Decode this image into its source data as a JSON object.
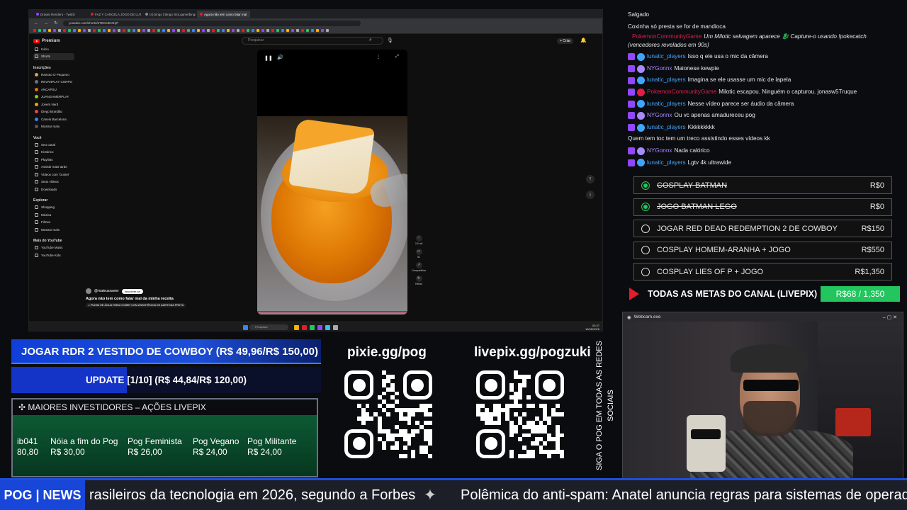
{
  "browser": {
    "tabs": [
      {
        "label": "Drawis Rendero - Twitch",
        "color": "#9146ff"
      },
      {
        "label": "FAZ Y CANCELA JOGO DE LUTA HOJE",
        "color": "#e11d2d"
      },
      {
        "label": "(4) bingo | Bingo Slot.game/bingo",
        "color": "#888888"
      },
      {
        "label": "Agora não tem como falar mal",
        "color": "#e11d2d",
        "active": true
      }
    ],
    "url": "youtube.com/shorts/6TDGs3N4HjP",
    "search_placeholder": "Pesquisar",
    "create_label": "+ Criar"
  },
  "yt_sidebar": {
    "brand": "Premium",
    "main": [
      "Início",
      "Shorts"
    ],
    "subs_title": "Inscrições",
    "subs": [
      "Ramoto O Pequeno",
      "REVANPLAY CORPO",
      "ANCAPSU",
      "JUANGAMERPLAY",
      "Jovem Nerd",
      "Diego Brandão",
      "Canelo Barcelona",
      "Mostrar mais"
    ],
    "you_title": "Você",
    "you": [
      "Seu canal",
      "Histórico",
      "Playlists",
      "Assistir mais tarde",
      "Vídeos com 'Gostei'",
      "Seus vídeos",
      "Downloads"
    ],
    "explore_title": "Explorar",
    "explore": [
      "Shopping",
      "Música",
      "Filmes",
      "Mostrar mais"
    ],
    "more_title": "Mais do YouTube",
    "more": [
      "YouTube Music",
      "YouTube Kids"
    ]
  },
  "short": {
    "channel": "@mateusxavier",
    "subscribe": "Inscrever-se",
    "title": "Agora não tem como falar mal da minha receita",
    "caption": "♫ PUDIM DE ÁGUA PARA COMER COM ASSISTÊNCIA DE AZEITONA PRETA",
    "side": [
      {
        "icon": "♡",
        "label": "2,5 mil"
      },
      {
        "icon": "▭",
        "label": "51"
      },
      {
        "icon": "↗",
        "label": "Compartilhar"
      },
      {
        "icon": "↻",
        "label": "Remix"
      }
    ]
  },
  "windows_taskbar": {
    "search": "Pesquisar",
    "time": "03:37",
    "date": "16/06/2026"
  },
  "chat": [
    {
      "user": "",
      "text": "Salgado",
      "color": "#e8e8e8"
    },
    {
      "user": "",
      "text": "Coxinha só presta se for de mandioca",
      "color": "#e8e8e8"
    },
    {
      "user": "PokemonCommunityGame",
      "text": "Um Milotic selvagem aparece 🐉 Capture-o usando !pokecatch (vencedores revelados em 90s)",
      "color": "#e11d48",
      "italic": true
    },
    {
      "user": "lunatic_players",
      "text": "Isso q ele usa o mic da câmera",
      "color": "#3ea6ff"
    },
    {
      "user": "NYGonnx",
      "text": "Maionese kewpie",
      "color": "#a78bfa"
    },
    {
      "user": "lunatic_players",
      "text": "Imagina se ele usasse um mic de lapela",
      "color": "#3ea6ff"
    },
    {
      "user": "PokemonCommunityGame",
      "text": "Milotic escapou. Ninguém o capturou. jonasw5Truque",
      "color": "#e11d48"
    },
    {
      "user": "lunatic_players",
      "text": "Nesse vídeo parece ser áudio da câmera",
      "color": "#3ea6ff"
    },
    {
      "user": "NYGonnx",
      "text": "Ou vc apenas amadureceu pog",
      "color": "#a78bfa"
    },
    {
      "user": "lunatic_players",
      "text": "Kkkkkkkkk",
      "color": "#3ea6ff"
    },
    {
      "user": "",
      "text": "Quem tem toc tem um treco assistindo esses vídeos kk",
      "color": "#e8e8e8"
    },
    {
      "user": "NYGonnx",
      "text": "Nada calórico",
      "color": "#a78bfa"
    },
    {
      "user": "lunatic_players",
      "text": "Lgtv 4k ultrawide",
      "color": "#3ea6ff"
    }
  ],
  "goals": [
    {
      "label": "COSPLAY BATMAN",
      "value": "R$0",
      "done": true
    },
    {
      "label": "JOGO BATMAN LEGO",
      "value": "R$0",
      "done": true
    },
    {
      "label": "JOGAR RED DEAD REDEMPTION 2 DE COWBOY",
      "value": "R$150",
      "done": false
    },
    {
      "label": "COSPLAY HOMEM-ARANHA + JOGO",
      "value": "R$550",
      "done": false
    },
    {
      "label": "COSPLAY LIES OF P + JOGO",
      "value": "R$1,350",
      "done": false
    }
  ],
  "meta": {
    "label": "TODAS AS METAS DO CANAL (LIVEPIX)",
    "value": "R$68 / 1,350"
  },
  "webcam": {
    "title": "Webcam.exe"
  },
  "rdr": {
    "label": "JOGAR RDR 2 VESTIDO DE COWBOY (R$ 49,96/R$ 150,00)"
  },
  "update": {
    "label": "UPDATE [1/10] (R$ 44,84/R$ 120,00)",
    "progress": 0.374
  },
  "investors": {
    "title": "MAIORES INVESTIDORES – AÇÕES LIVEPIX",
    "items": [
      {
        "name": "ib041",
        "value": "80,80"
      },
      {
        "name": "Nóia a fim do Pog",
        "value": "R$ 30,00"
      },
      {
        "name": "Pog Feminista",
        "value": "R$ 26,00"
      },
      {
        "name": "Pog Vegano",
        "value": "R$ 24,00"
      },
      {
        "name": "Pog Militante",
        "value": "R$ 24,00"
      }
    ]
  },
  "qr": {
    "left_title": "pixie.gg/pog",
    "right_title": "livepix.gg/pogzuki"
  },
  "social": "SIGA O POG EM TODAS AS REDES SOCIAIS",
  "ticker": {
    "brand": "POG | NEWS",
    "item1": "rasileiros da tecnologia em 2026, segundo a Forbes",
    "item2": "Polêmica do anti-spam: Anatel anuncia regras para sistemas de operadoras"
  }
}
